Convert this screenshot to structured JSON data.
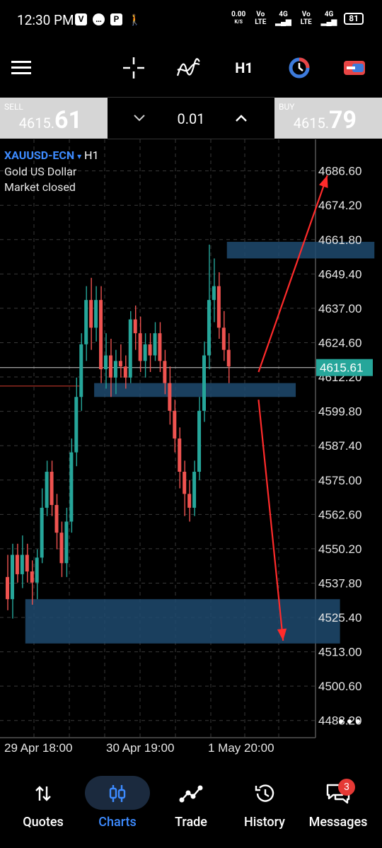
{
  "status_bar": {
    "time": "12:30 PM",
    "icons": [
      "whatsapp-icon",
      "chat-icon",
      "pay-icon",
      "walking-icon"
    ],
    "net_speed": "0.00",
    "net_unit": "K/S",
    "sim1": "Vo LTE",
    "sim1_sig": "4G",
    "sim2": "Vo LTE",
    "sim2_sig": "4G",
    "battery": "81"
  },
  "toolbar": {
    "timeframe": "H1",
    "icons": [
      "menu-icon",
      "crosshair-icon",
      "indicators-icon",
      "timeframe-label",
      "time-icon",
      "trade-toggle-icon"
    ]
  },
  "trade": {
    "sell_label": "SELL",
    "sell_small": "4615.",
    "sell_big": "61",
    "lot": "0.01",
    "buy_label": "BUY",
    "buy_small": "4615.",
    "buy_big": "79"
  },
  "chart": {
    "symbol": "XAUUSD-ECN",
    "symbol_arrow": "▾",
    "timeframe": "H1",
    "description": "Gold US Dollar",
    "market_status": "Market closed",
    "current_price": "4615.61",
    "price_labels": [
      "4686.60",
      "4674.20",
      "4661.80",
      "4649.40",
      "4637.00",
      "4624.60",
      "4612.20",
      "4599.80",
      "4587.40",
      "4575.00",
      "4562.60",
      "4550.20",
      "4537.80",
      "4525.40",
      "4513.00",
      "4500.60",
      "4488.20"
    ],
    "time_labels": [
      "29 Apr 18:00",
      "30 Apr 19:00",
      "1 May 20:00"
    ],
    "colors": {
      "bull": "#26a69a",
      "bear": "#ef5350",
      "zone": "#1e4a6e",
      "arrow": "#ff2b2b",
      "bid": "#cfcfcf"
    }
  },
  "chart_data": {
    "type": "candlestick",
    "symbol": "XAUUSD-ECN",
    "timeframe": "H1",
    "ylim": [
      4482,
      4698
    ],
    "last_price": 4615.61,
    "candles": [
      [
        4540,
        4548,
        4528,
        4532
      ],
      [
        4532,
        4552,
        4525,
        4548
      ],
      [
        4548,
        4552,
        4538,
        4541
      ],
      [
        4541,
        4555,
        4536,
        4548
      ],
      [
        4548,
        4552,
        4538,
        4542
      ],
      [
        4542,
        4546,
        4530,
        4538
      ],
      [
        4538,
        4550,
        4532,
        4547
      ],
      [
        4547,
        4572,
        4545,
        4565
      ],
      [
        4565,
        4582,
        4562,
        4578
      ],
      [
        4578,
        4582,
        4562,
        4566
      ],
      [
        4566,
        4570,
        4550,
        4556
      ],
      [
        4556,
        4560,
        4540,
        4545
      ],
      [
        4545,
        4565,
        4540,
        4560
      ],
      [
        4560,
        4590,
        4556,
        4585
      ],
      [
        4585,
        4612,
        4580,
        4605
      ],
      [
        4605,
        4628,
        4600,
        4624
      ],
      [
        4624,
        4645,
        4618,
        4640
      ],
      [
        4640,
        4648,
        4622,
        4630
      ],
      [
        4630,
        4645,
        4625,
        4640
      ],
      [
        4640,
        4645,
        4610,
        4615
      ],
      [
        4615,
        4628,
        4608,
        4620
      ],
      [
        4620,
        4626,
        4605,
        4612
      ],
      [
        4612,
        4622,
        4606,
        4618
      ],
      [
        4618,
        4624,
        4612,
        4616
      ],
      [
        4616,
        4620,
        4608,
        4612
      ],
      [
        4612,
        4636,
        4610,
        4633
      ],
      [
        4633,
        4638,
        4622,
        4628
      ],
      [
        4628,
        4634,
        4614,
        4618
      ],
      [
        4618,
        4628,
        4612,
        4624
      ],
      [
        4624,
        4628,
        4614,
        4620
      ],
      [
        4620,
        4632,
        4618,
        4628
      ],
      [
        4628,
        4632,
        4614,
        4618
      ],
      [
        4618,
        4622,
        4606,
        4610
      ],
      [
        4610,
        4616,
        4595,
        4600
      ],
      [
        4600,
        4604,
        4585,
        4590
      ],
      [
        4590,
        4594,
        4572,
        4578
      ],
      [
        4578,
        4582,
        4562,
        4570
      ],
      [
        4570,
        4575,
        4560,
        4565
      ],
      [
        4565,
        4582,
        4562,
        4578
      ],
      [
        4578,
        4605,
        4575,
        4600
      ],
      [
        4600,
        4625,
        4596,
        4620
      ],
      [
        4620,
        4660,
        4615,
        4640
      ],
      [
        4640,
        4655,
        4632,
        4645
      ],
      [
        4645,
        4650,
        4626,
        4630
      ],
      [
        4630,
        4636,
        4618,
        4622
      ],
      [
        4622,
        4628,
        4610,
        4616
      ]
    ],
    "zones": [
      {
        "t0": 45,
        "t1": 75,
        "low": 4655,
        "high": 4661
      },
      {
        "t0": 18,
        "t1": 59,
        "low": 4605,
        "high": 4610
      },
      {
        "t0": 4,
        "t1": 68,
        "low": 4516,
        "high": 4532
      }
    ],
    "arrows": [
      {
        "from": [
          51,
          4614
        ],
        "to": [
          65,
          4685
        ]
      },
      {
        "from": [
          51,
          4604
        ],
        "to": [
          56,
          4517
        ]
      }
    ],
    "hline": 4612
  },
  "bottom_nav": {
    "items": [
      {
        "label": "Quotes",
        "icon": "swap-vertical-icon"
      },
      {
        "label": "Charts",
        "icon": "candles-icon"
      },
      {
        "label": "Trade",
        "icon": "trend-line-icon"
      },
      {
        "label": "History",
        "icon": "history-icon"
      },
      {
        "label": "Messages",
        "icon": "messages-icon"
      }
    ],
    "active": "Charts",
    "badge": "3"
  }
}
